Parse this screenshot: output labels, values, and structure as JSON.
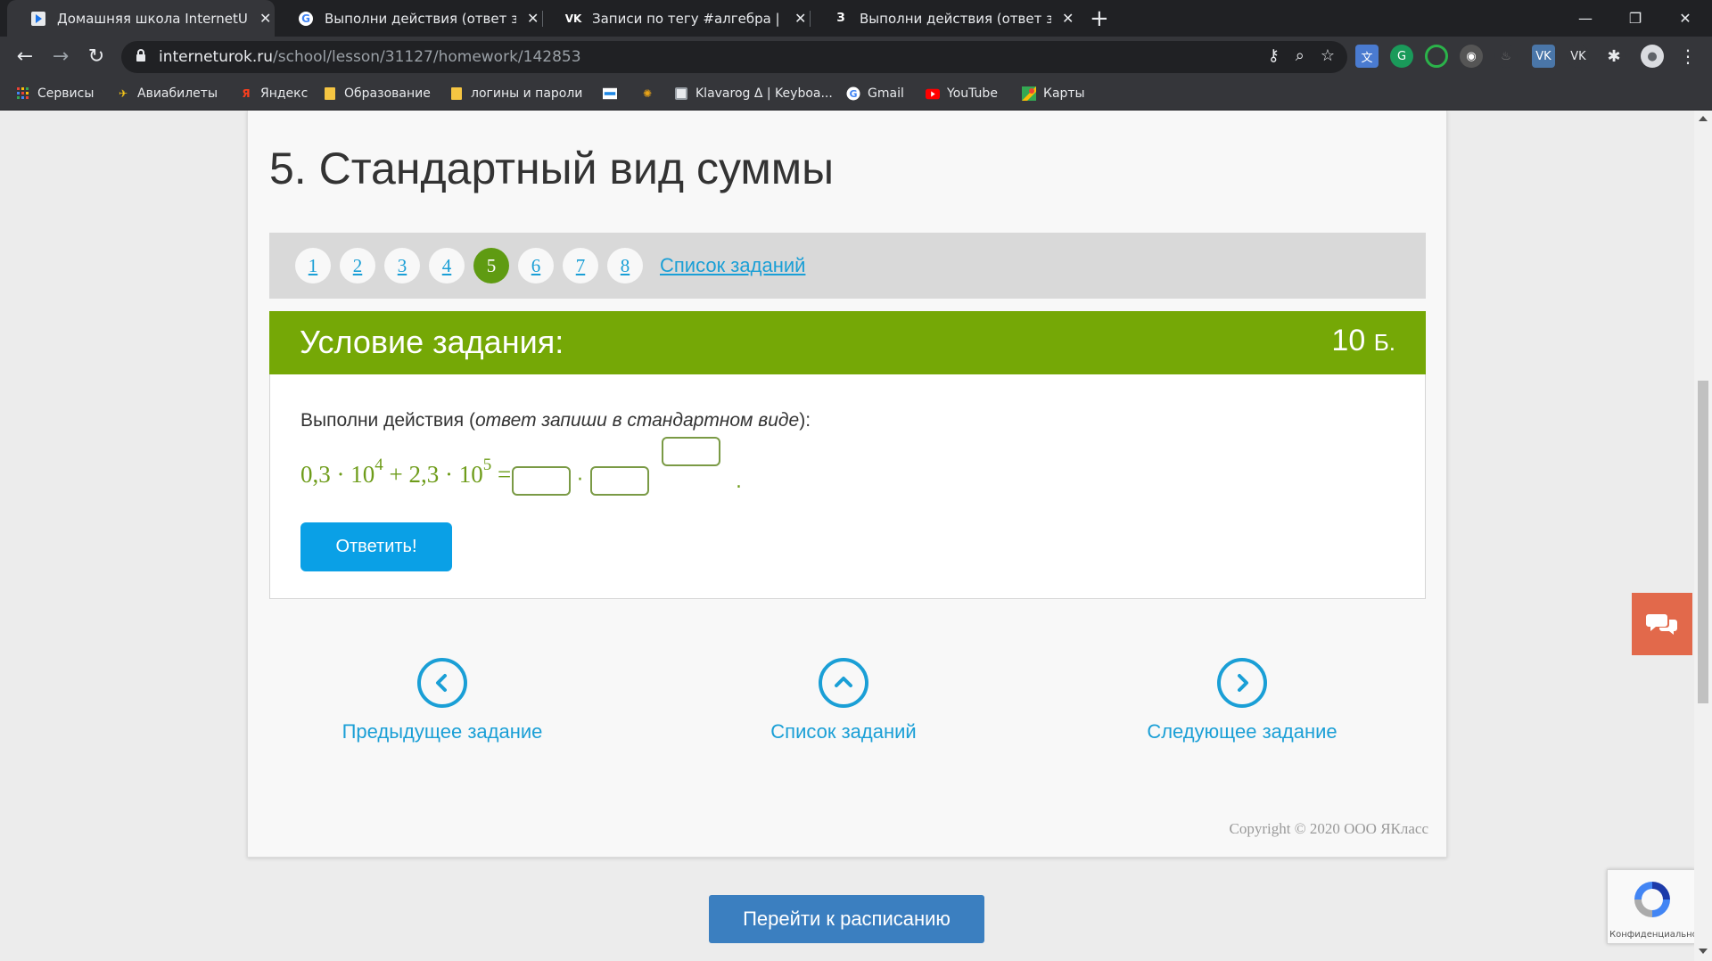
{
  "browser": {
    "tabs": [
      {
        "title": "Домашняя школа InternetUrok.ru"
      },
      {
        "title": "Выполни действия (ответ запиши"
      },
      {
        "title": "Записи по тегу #алгебра | фан г"
      },
      {
        "title": "Выполни действия (ответ запиши"
      }
    ],
    "url_host": "interneturok.ru",
    "url_path": "/school/lesson/31127/homework/142853",
    "bookmarks": [
      {
        "label": "Сервисы"
      },
      {
        "label": "Авиабилеты"
      },
      {
        "label": "Яндекс"
      },
      {
        "label": "Образование"
      },
      {
        "label": "логины и пароли"
      },
      {
        "label": "Klavarog Δ | Keyboa..."
      },
      {
        "label": "Gmail"
      },
      {
        "label": "YouTube"
      },
      {
        "label": "Карты"
      }
    ],
    "tab3_favicon": "З",
    "bm_yandex_glyph": "Я"
  },
  "page": {
    "title": "5. Стандартный вид суммы",
    "question_numbers": [
      "1",
      "2",
      "3",
      "4",
      "5",
      "6",
      "7",
      "8"
    ],
    "active_question": "5",
    "task_list_link": "Список заданий",
    "task": {
      "header": "Условие задания:",
      "points_value": "10",
      "points_unit": "Б.",
      "instruction_prefix": "Выполни действия (",
      "instruction_italic": "ответ запиши в стандартном виде",
      "instruction_suffix": "):",
      "formula": {
        "a": "0,3 · 10",
        "a_exp": "4",
        "plus": " + 2,3 · 10",
        "b_exp": "5",
        "eq": " ="
      },
      "dot": "·",
      "period": ".",
      "answer_button": "Ответить!"
    },
    "nav": {
      "prev": "Предыдущее задание",
      "list": "Список заданий",
      "next": "Следующее задание"
    },
    "copyright": "Copyright © 2020 ООО ЯКласс",
    "schedule_button": "Перейти к расписанию",
    "recaptcha_text": "Конфиденциальность"
  },
  "colors": {
    "green_header": "#75a806",
    "active_number": "#5f9b12",
    "link_blue": "#1a9fd6",
    "answer_button": "#0aa0e6",
    "schedule_button": "#3b7fc0",
    "chat_button": "#e2694b"
  }
}
